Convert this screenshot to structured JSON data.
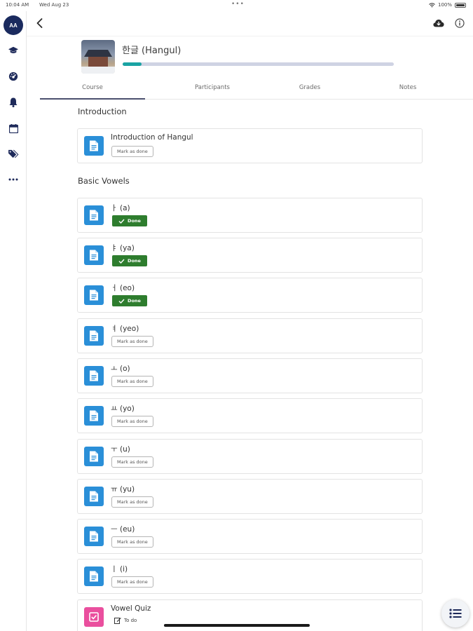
{
  "status_bar": {
    "time": "10:04 AM",
    "date": "Wed Aug 23",
    "battery": "100%"
  },
  "sidebar": {
    "avatar_initials": "AA",
    "icons": [
      "graduation-cap-icon",
      "dashboard-icon",
      "bell-icon",
      "calendar-icon",
      "tags-icon",
      "more-icon"
    ],
    "avatar_color": "#1a2a5e"
  },
  "course": {
    "title": "한글 (Hangul)",
    "progress_percent": 7,
    "progress_color": "#1aa3a3"
  },
  "tabs": [
    {
      "label": "Course",
      "active": true
    },
    {
      "label": "Participants",
      "active": false
    },
    {
      "label": "Grades",
      "active": false
    },
    {
      "label": "Notes",
      "active": false
    }
  ],
  "sections": [
    {
      "title": "Introduction",
      "activities": [
        {
          "title": "Introduction of Hangul",
          "type": "page",
          "status": "mark",
          "status_label": "Mark as done"
        }
      ]
    },
    {
      "title": "Basic Vowels",
      "activities": [
        {
          "title": "ㅏ (a)",
          "type": "page",
          "status": "done",
          "status_label": "Done"
        },
        {
          "title": "ㅑ (ya)",
          "type": "page",
          "status": "done",
          "status_label": "Done"
        },
        {
          "title": "ㅓ (eo)",
          "type": "page",
          "status": "done",
          "status_label": "Done"
        },
        {
          "title": "ㅕ (yeo)",
          "type": "page",
          "status": "mark",
          "status_label": "Mark as done"
        },
        {
          "title": "ㅗ (o)",
          "type": "page",
          "status": "mark",
          "status_label": "Mark as done"
        },
        {
          "title": "ㅛ (yo)",
          "type": "page",
          "status": "mark",
          "status_label": "Mark as done"
        },
        {
          "title": "ㅜ (u)",
          "type": "page",
          "status": "mark",
          "status_label": "Mark as done"
        },
        {
          "title": "ㅠ (yu)",
          "type": "page",
          "status": "mark",
          "status_label": "Mark as done"
        },
        {
          "title": "ㅡ (eu)",
          "type": "page",
          "status": "mark",
          "status_label": "Mark as done"
        },
        {
          "title": "ㅣ (i)",
          "type": "page",
          "status": "mark",
          "status_label": "Mark as done"
        },
        {
          "title": "Vowel Quiz",
          "type": "quiz",
          "status": "todo",
          "status_label": "To do"
        }
      ]
    }
  ],
  "colors": {
    "page_icon": "#2a8fd8",
    "quiz_icon": "#ea4f9e",
    "done_badge": "#2e7d2e"
  }
}
